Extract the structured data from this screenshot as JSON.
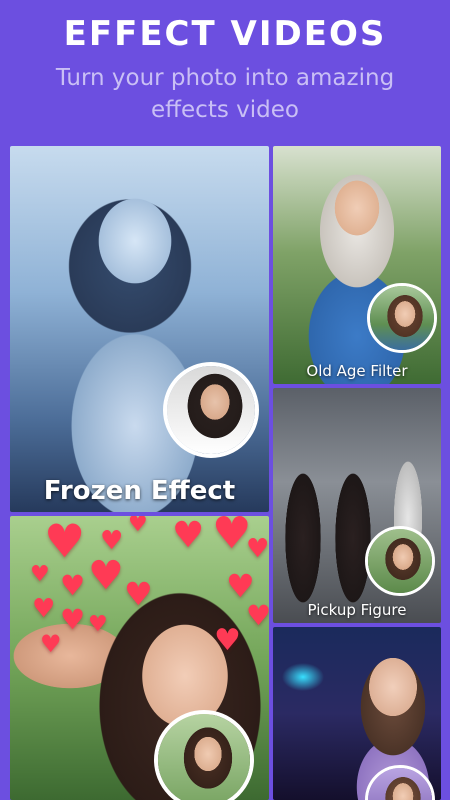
{
  "header": {
    "title": "EFFECT VIDEOS",
    "subtitle": "Turn your photo into amazing effects video"
  },
  "cards": [
    {
      "label": "Frozen Effect"
    },
    {
      "label": "Old Age Filter"
    },
    {
      "label": "Pickup Figure"
    },
    {
      "label": ""
    },
    {
      "label": ""
    }
  ],
  "colors": {
    "background": "#6c4fe0",
    "title": "#ffffff",
    "subtitle": "#c9bff5",
    "heart": "#ff3a55"
  },
  "icons": [
    "heart-icon"
  ]
}
